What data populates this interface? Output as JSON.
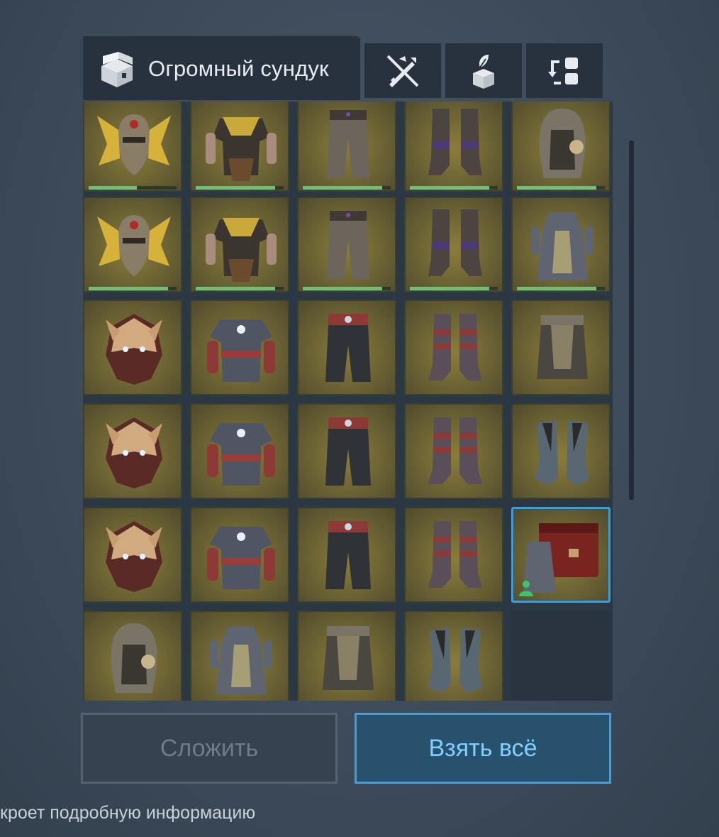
{
  "header": {
    "title": "Огромный сундук",
    "title_icon": "chest-icon",
    "tools": [
      {
        "name": "filter-off-button",
        "icon": "no-sword-icon"
      },
      {
        "name": "deposit-button",
        "icon": "box-with-leaf-icon"
      },
      {
        "name": "swap-button",
        "icon": "swap-layout-icon"
      }
    ]
  },
  "inventory": {
    "rows": [
      [
        "winged-helmet",
        "tribal-tunic",
        "leather-trousers",
        "laced-boots",
        "hooded-helm"
      ],
      [
        "winged-helmet",
        "tribal-tunic",
        "leather-trousers",
        "laced-boots",
        "robe-dress"
      ],
      [
        "fox-mask",
        "studded-jacket",
        "banded-trousers",
        "banded-boots",
        "fringed-skirt"
      ],
      [
        "fox-mask",
        "studded-jacket",
        "banded-trousers",
        "banded-boots",
        "cloth-shoes"
      ],
      [
        "fox-mask",
        "studded-jacket",
        "banded-trousers",
        "banded-boots",
        "chest-with-robe"
      ],
      [
        "hooded-helm",
        "robe-dress",
        "fringed-skirt",
        "cloth-shoes",
        "empty"
      ]
    ],
    "durability": [
      [
        0.55,
        0.9,
        0.9,
        0.9,
        0.9
      ],
      [
        0.9,
        0.9,
        0.9,
        0.9,
        0.9
      ],
      [
        null,
        null,
        null,
        null,
        null
      ],
      [
        null,
        null,
        null,
        null,
        null
      ],
      [
        null,
        null,
        null,
        null,
        null
      ],
      [
        null,
        null,
        null,
        null,
        null
      ]
    ],
    "selected": "row-5-col-5",
    "colors": {
      "slot_bg": "#6a6133",
      "selected_border": "#3d9fd6",
      "durability": "#6fbf7a",
      "owner_icon": "#3ec36b"
    }
  },
  "buttons": {
    "stack_label": "Сложить",
    "take_all_label": "Взять всё"
  },
  "hint": "кроет подробную информацию"
}
